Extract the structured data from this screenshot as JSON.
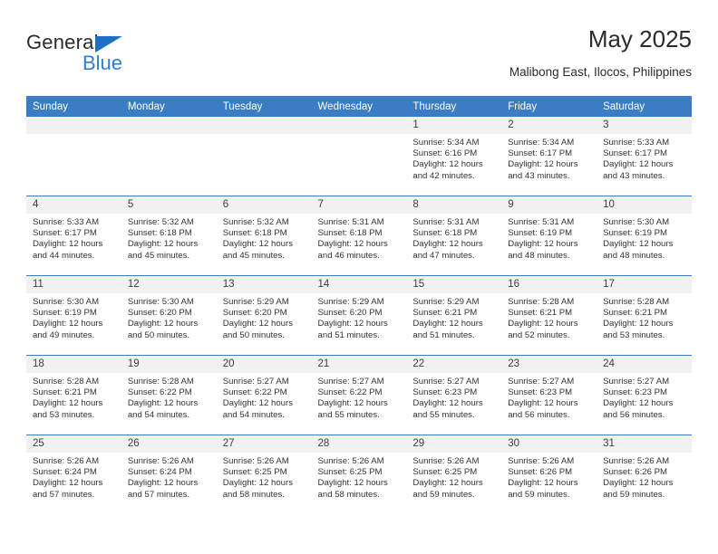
{
  "brand": {
    "name_top": "General",
    "name_bottom": "Blue"
  },
  "header": {
    "title": "May 2025",
    "location": "Malibong East, Ilocos, Philippines"
  },
  "colors": {
    "header_blue": "#3b7dc4",
    "brand_blue": "#2f7fd0",
    "daystrip_gray": "#f1f1f1"
  },
  "weekdays": [
    "Sunday",
    "Monday",
    "Tuesday",
    "Wednesday",
    "Thursday",
    "Friday",
    "Saturday"
  ],
  "weeks": [
    [
      {
        "day": "",
        "empty": true
      },
      {
        "day": "",
        "empty": true
      },
      {
        "day": "",
        "empty": true
      },
      {
        "day": "",
        "empty": true
      },
      {
        "day": "1",
        "sunrise": "Sunrise: 5:34 AM",
        "sunset": "Sunset: 6:16 PM",
        "daylight": "Daylight: 12 hours and 42 minutes."
      },
      {
        "day": "2",
        "sunrise": "Sunrise: 5:34 AM",
        "sunset": "Sunset: 6:17 PM",
        "daylight": "Daylight: 12 hours and 43 minutes."
      },
      {
        "day": "3",
        "sunrise": "Sunrise: 5:33 AM",
        "sunset": "Sunset: 6:17 PM",
        "daylight": "Daylight: 12 hours and 43 minutes."
      }
    ],
    [
      {
        "day": "4",
        "sunrise": "Sunrise: 5:33 AM",
        "sunset": "Sunset: 6:17 PM",
        "daylight": "Daylight: 12 hours and 44 minutes."
      },
      {
        "day": "5",
        "sunrise": "Sunrise: 5:32 AM",
        "sunset": "Sunset: 6:18 PM",
        "daylight": "Daylight: 12 hours and 45 minutes."
      },
      {
        "day": "6",
        "sunrise": "Sunrise: 5:32 AM",
        "sunset": "Sunset: 6:18 PM",
        "daylight": "Daylight: 12 hours and 45 minutes."
      },
      {
        "day": "7",
        "sunrise": "Sunrise: 5:31 AM",
        "sunset": "Sunset: 6:18 PM",
        "daylight": "Daylight: 12 hours and 46 minutes."
      },
      {
        "day": "8",
        "sunrise": "Sunrise: 5:31 AM",
        "sunset": "Sunset: 6:18 PM",
        "daylight": "Daylight: 12 hours and 47 minutes."
      },
      {
        "day": "9",
        "sunrise": "Sunrise: 5:31 AM",
        "sunset": "Sunset: 6:19 PM",
        "daylight": "Daylight: 12 hours and 48 minutes."
      },
      {
        "day": "10",
        "sunrise": "Sunrise: 5:30 AM",
        "sunset": "Sunset: 6:19 PM",
        "daylight": "Daylight: 12 hours and 48 minutes."
      }
    ],
    [
      {
        "day": "11",
        "sunrise": "Sunrise: 5:30 AM",
        "sunset": "Sunset: 6:19 PM",
        "daylight": "Daylight: 12 hours and 49 minutes."
      },
      {
        "day": "12",
        "sunrise": "Sunrise: 5:30 AM",
        "sunset": "Sunset: 6:20 PM",
        "daylight": "Daylight: 12 hours and 50 minutes."
      },
      {
        "day": "13",
        "sunrise": "Sunrise: 5:29 AM",
        "sunset": "Sunset: 6:20 PM",
        "daylight": "Daylight: 12 hours and 50 minutes."
      },
      {
        "day": "14",
        "sunrise": "Sunrise: 5:29 AM",
        "sunset": "Sunset: 6:20 PM",
        "daylight": "Daylight: 12 hours and 51 minutes."
      },
      {
        "day": "15",
        "sunrise": "Sunrise: 5:29 AM",
        "sunset": "Sunset: 6:21 PM",
        "daylight": "Daylight: 12 hours and 51 minutes."
      },
      {
        "day": "16",
        "sunrise": "Sunrise: 5:28 AM",
        "sunset": "Sunset: 6:21 PM",
        "daylight": "Daylight: 12 hours and 52 minutes."
      },
      {
        "day": "17",
        "sunrise": "Sunrise: 5:28 AM",
        "sunset": "Sunset: 6:21 PM",
        "daylight": "Daylight: 12 hours and 53 minutes."
      }
    ],
    [
      {
        "day": "18",
        "sunrise": "Sunrise: 5:28 AM",
        "sunset": "Sunset: 6:21 PM",
        "daylight": "Daylight: 12 hours and 53 minutes."
      },
      {
        "day": "19",
        "sunrise": "Sunrise: 5:28 AM",
        "sunset": "Sunset: 6:22 PM",
        "daylight": "Daylight: 12 hours and 54 minutes."
      },
      {
        "day": "20",
        "sunrise": "Sunrise: 5:27 AM",
        "sunset": "Sunset: 6:22 PM",
        "daylight": "Daylight: 12 hours and 54 minutes."
      },
      {
        "day": "21",
        "sunrise": "Sunrise: 5:27 AM",
        "sunset": "Sunset: 6:22 PM",
        "daylight": "Daylight: 12 hours and 55 minutes."
      },
      {
        "day": "22",
        "sunrise": "Sunrise: 5:27 AM",
        "sunset": "Sunset: 6:23 PM",
        "daylight": "Daylight: 12 hours and 55 minutes."
      },
      {
        "day": "23",
        "sunrise": "Sunrise: 5:27 AM",
        "sunset": "Sunset: 6:23 PM",
        "daylight": "Daylight: 12 hours and 56 minutes."
      },
      {
        "day": "24",
        "sunrise": "Sunrise: 5:27 AM",
        "sunset": "Sunset: 6:23 PM",
        "daylight": "Daylight: 12 hours and 56 minutes."
      }
    ],
    [
      {
        "day": "25",
        "sunrise": "Sunrise: 5:26 AM",
        "sunset": "Sunset: 6:24 PM",
        "daylight": "Daylight: 12 hours and 57 minutes."
      },
      {
        "day": "26",
        "sunrise": "Sunrise: 5:26 AM",
        "sunset": "Sunset: 6:24 PM",
        "daylight": "Daylight: 12 hours and 57 minutes."
      },
      {
        "day": "27",
        "sunrise": "Sunrise: 5:26 AM",
        "sunset": "Sunset: 6:25 PM",
        "daylight": "Daylight: 12 hours and 58 minutes."
      },
      {
        "day": "28",
        "sunrise": "Sunrise: 5:26 AM",
        "sunset": "Sunset: 6:25 PM",
        "daylight": "Daylight: 12 hours and 58 minutes."
      },
      {
        "day": "29",
        "sunrise": "Sunrise: 5:26 AM",
        "sunset": "Sunset: 6:25 PM",
        "daylight": "Daylight: 12 hours and 59 minutes."
      },
      {
        "day": "30",
        "sunrise": "Sunrise: 5:26 AM",
        "sunset": "Sunset: 6:26 PM",
        "daylight": "Daylight: 12 hours and 59 minutes."
      },
      {
        "day": "31",
        "sunrise": "Sunrise: 5:26 AM",
        "sunset": "Sunset: 6:26 PM",
        "daylight": "Daylight: 12 hours and 59 minutes."
      }
    ]
  ]
}
